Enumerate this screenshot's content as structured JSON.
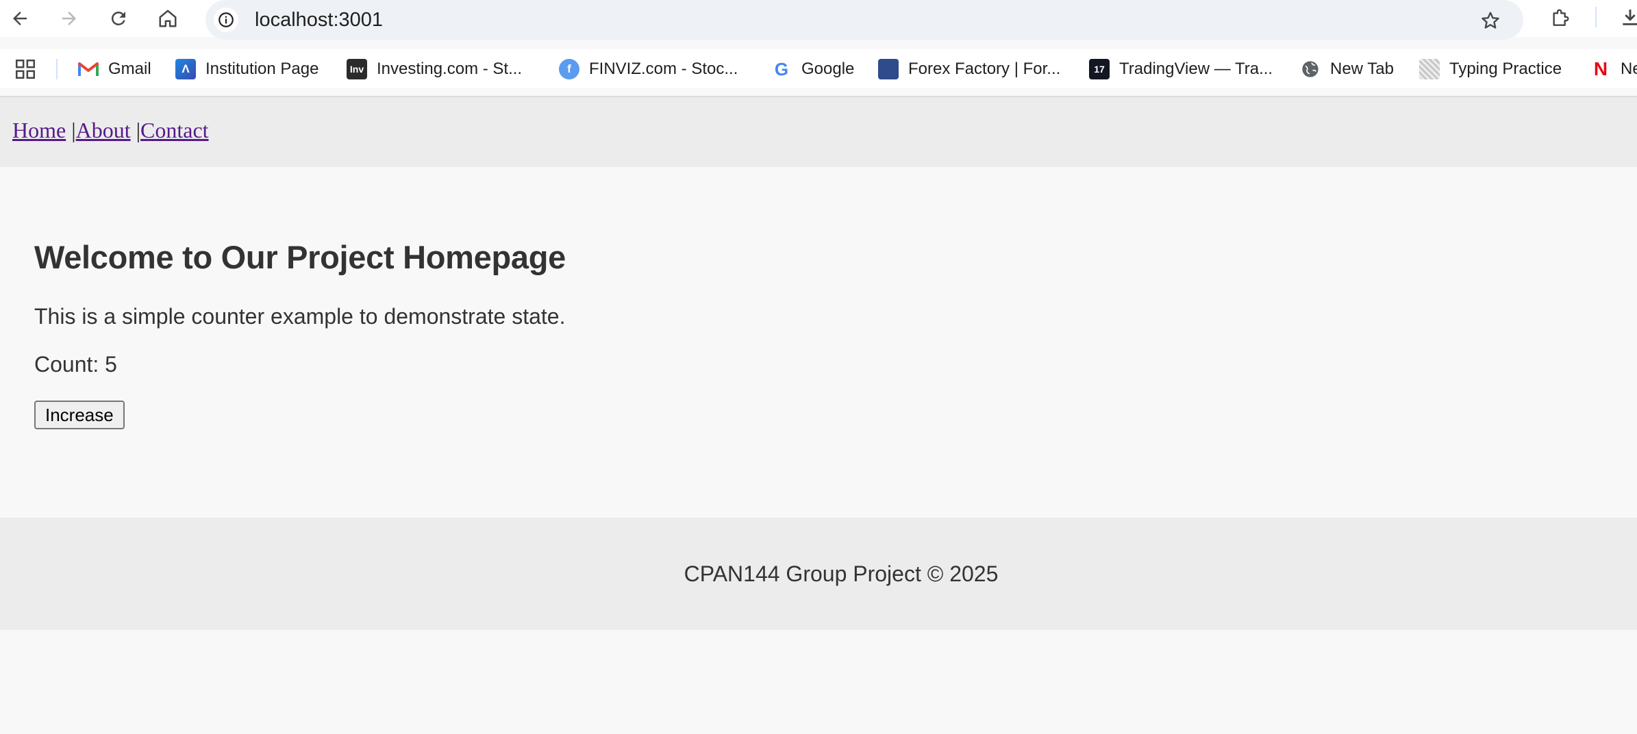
{
  "browser": {
    "url": "localhost:3001",
    "bookmarks": [
      {
        "label": "Gmail",
        "icon": "gmail-icon"
      },
      {
        "label": "Institution Page",
        "icon": "institution-icon"
      },
      {
        "label": "Investing.com - St...",
        "icon": "investing-icon"
      },
      {
        "label": "FINVIZ.com - Stoc...",
        "icon": "finviz-icon"
      },
      {
        "label": "Google",
        "icon": "google-icon"
      },
      {
        "label": "Forex Factory | For...",
        "icon": "forex-factory-icon"
      },
      {
        "label": "TradingView — Tra...",
        "icon": "tradingview-icon"
      },
      {
        "label": "New Tab",
        "icon": "globe-icon"
      },
      {
        "label": "Typing Practice",
        "icon": "typing-practice-icon"
      },
      {
        "label": "Ne",
        "icon": "netflix-icon"
      }
    ]
  },
  "nav": {
    "links": [
      "Home",
      "About",
      "Contact"
    ],
    "separator": "|"
  },
  "main": {
    "title": "Welcome to Our Project Homepage",
    "intro": "This is a simple counter example to demonstrate state.",
    "count_label": "Count: 5",
    "button_label": "Increase"
  },
  "footer": {
    "text": "CPAN144 Group Project © 2025"
  },
  "colors": {
    "nav_bg": "#ececec",
    "page_bg": "#f8f8f8",
    "visited_link": "#551a8b",
    "text": "#333333"
  }
}
